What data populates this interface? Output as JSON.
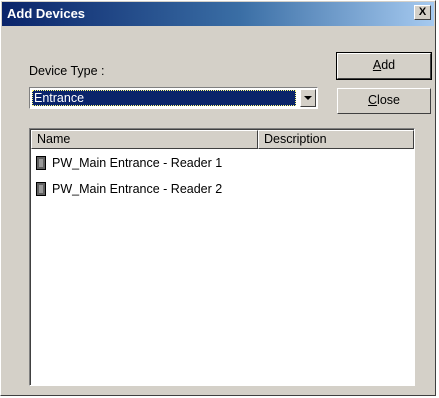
{
  "window": {
    "title": "Add Devices",
    "close_glyph": "X"
  },
  "device_type": {
    "label": "Device Type :",
    "selected": "Entrance"
  },
  "buttons": {
    "add_label": "Add",
    "add_mnemonic": "A",
    "add_rest": "dd",
    "close_label": "Close",
    "close_mnemonic": "C",
    "close_rest": "lose"
  },
  "list": {
    "columns": [
      "Name",
      "Description"
    ],
    "rows": [
      {
        "name": "PW_Main Entrance - Reader 1",
        "description": "",
        "icon": "reader-device-icon"
      },
      {
        "name": "PW_Main Entrance - Reader 2",
        "description": "",
        "icon": "reader-device-icon"
      }
    ]
  },
  "colors": {
    "titlebar_start": "#0a246a",
    "titlebar_end": "#a6caf0",
    "dialog_face": "#d4d0c8",
    "selection": "#0a246a"
  }
}
